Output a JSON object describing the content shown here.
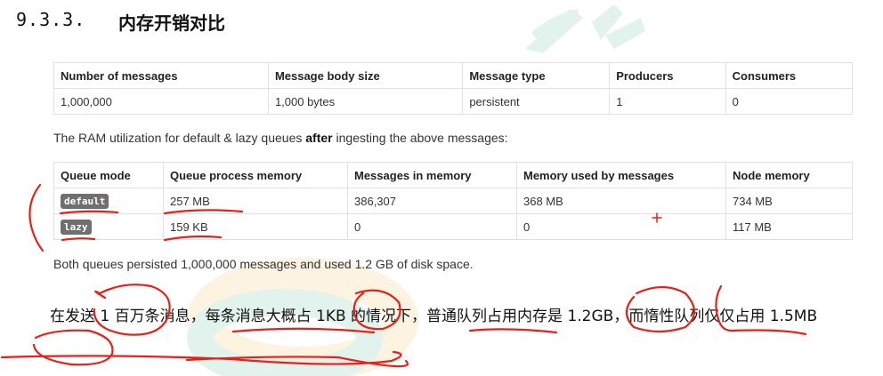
{
  "heading": {
    "number": "9.3.3.",
    "title": "内存开销对比"
  },
  "table1": {
    "headers": [
      "Number of messages",
      "Message body size",
      "Message type",
      "Producers",
      "Consumers"
    ],
    "row": [
      "1,000,000",
      "1,000 bytes",
      "persistent",
      "1",
      "0"
    ]
  },
  "caption": {
    "before": "The RAM utilization for default & lazy queues ",
    "bold": "after",
    "after": " ingesting the above messages:"
  },
  "table2": {
    "headers": [
      "Queue mode",
      "Queue process memory",
      "Messages in memory",
      "Memory used by messages",
      "Node memory"
    ],
    "rows": [
      [
        "default",
        "257 MB",
        "386,307",
        "368 MB",
        "734 MB"
      ],
      [
        "lazy",
        "159 KB",
        "0",
        "0",
        "117 MB"
      ]
    ]
  },
  "footnote": "Both queues persisted 1,000,000 messages and used 1.2 GB of disk space.",
  "paragraph": "在发送 1 百万条消息，每条消息大概占 1KB 的情况下，普通队列占用内存是 1.2GB，而惰性队列仅仅占用 1.5MB",
  "colors": {
    "annotation": "#e8201a",
    "watermark_green": "#7fc8b0",
    "watermark_yellow": "#f3d27a",
    "badge": "#6f6f6f"
  }
}
